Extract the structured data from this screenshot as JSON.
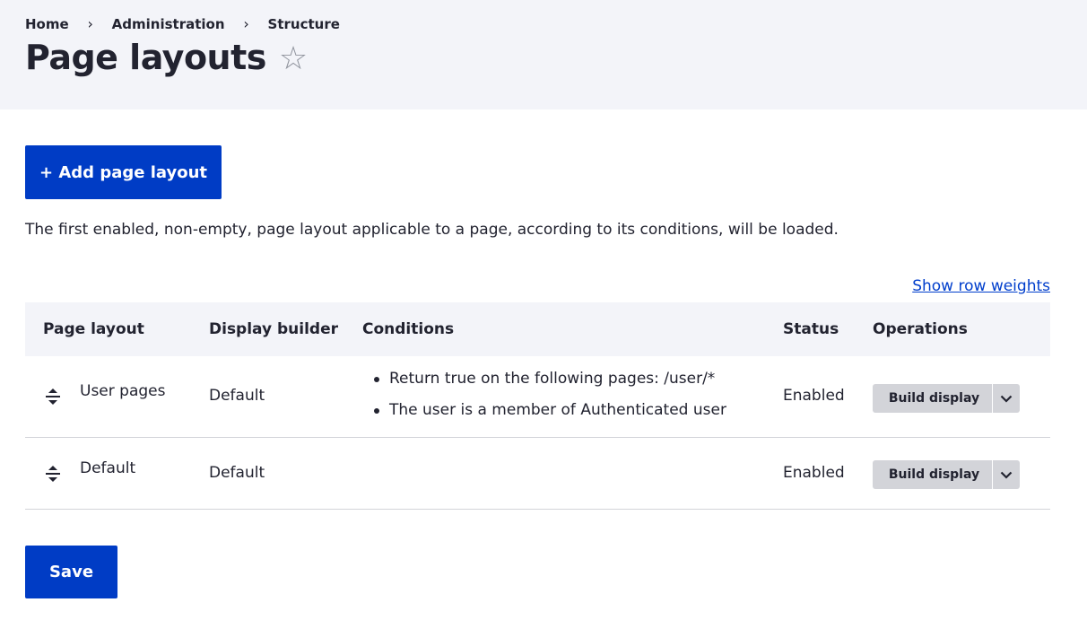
{
  "breadcrumb": {
    "items": [
      "Home",
      "Administration",
      "Structure"
    ],
    "separator": "›"
  },
  "header": {
    "title": "Page layouts",
    "favorite_icon": "star-outline-icon"
  },
  "actions": {
    "add_label": "+ Add page layout"
  },
  "description": "The first enabled, non-empty, page layout applicable to a page, according to its conditions, will be loaded.",
  "table": {
    "show_row_weights": "Show row weights",
    "headers": [
      "Page layout",
      "Display builder",
      "Conditions",
      "Status",
      "Operations"
    ],
    "rows": [
      {
        "page_layout": "User pages",
        "display_builder": "Default",
        "conditions": [
          "Return true on the following pages: /user/*",
          "The user is a member of Authenticated user"
        ],
        "status": "Enabled",
        "operation": "Build display"
      },
      {
        "page_layout": "Default",
        "display_builder": "Default",
        "conditions": [],
        "status": "Enabled",
        "operation": "Build display"
      }
    ]
  },
  "form": {
    "save_label": "Save"
  },
  "colors": {
    "primary": "#003cc5",
    "link": "#003ecc",
    "header_bg": "#f3f4f9"
  }
}
